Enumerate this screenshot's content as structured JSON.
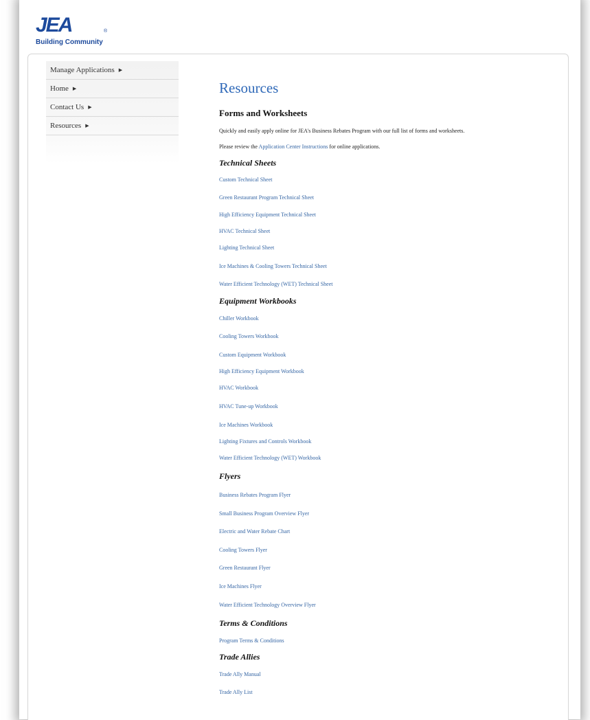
{
  "header": {
    "logo_text": "JEA",
    "logo_mark": "®",
    "tagline": "Building Community"
  },
  "sidebar": {
    "arrow_glyph": "▶",
    "items": [
      {
        "label": "Manage Applications"
      },
      {
        "label": "Home"
      },
      {
        "label": "Contact Us"
      },
      {
        "label": "Resources"
      }
    ]
  },
  "main": {
    "title": "Resources",
    "forms_heading": "Forms and Worksheets",
    "intro_text": "Quickly and easily apply online for JEA's Business Rebates Program with our full list of forms and worksheets.",
    "review_prefix": "Please review the ",
    "review_link": "Application Center Instructions",
    "review_suffix": " for online applications.",
    "technical_sheets": {
      "heading": "Technical Sheets",
      "links": [
        "Custom Technical Sheet",
        "Green Restaurant Program Technical Sheet",
        "High Efficiency Equipment Technical Sheet",
        "HVAC Technical Sheet",
        "Lighting Technical Sheet",
        "Ice Machines & Cooling Towers Technical Sheet",
        "Water Efficient Technology (WET) Technical Sheet"
      ]
    },
    "equipment_workbooks": {
      "heading": "Equipment Workbooks",
      "links": [
        "Chiller Workbook",
        "Cooling Towers Workbook",
        "Custom Equipment Workbook",
        "High Efficiency Equipment Workbook",
        "HVAC Workbook",
        "HVAC Tune-up Workbook",
        "Ice Machines Workbook",
        "Lighting Fixtures and Controls Workbook",
        "Water Efficient Technology (WET) Workbook"
      ]
    },
    "flyers": {
      "heading": "Flyers",
      "links": [
        "Business Rebates Program Flyer",
        "Small Business Program Overview Flyer",
        "Electric and Water Rebate Chart",
        "Cooling Towers Flyer",
        "Green Restaurant Flyer",
        "Ice Machines Flyer",
        "Water Efficient Technology Overview Flyer"
      ]
    },
    "terms": {
      "heading": "Terms & Conditions",
      "links": [
        "Program Terms & Conditions"
      ]
    },
    "trade_allies": {
      "heading": "Trade Allies",
      "links": [
        "Trade Ally Manual",
        "Trade Ally List"
      ]
    }
  },
  "colors": {
    "brand_blue": "#1d4a9c",
    "link_blue": "#3465a4",
    "title_blue": "#2f69b8"
  }
}
